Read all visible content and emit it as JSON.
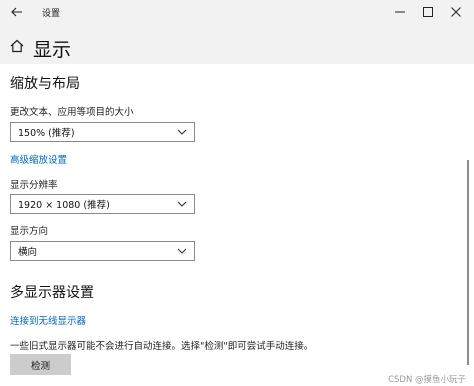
{
  "window": {
    "title": "设置",
    "back_icon": "back-arrow-icon",
    "minimize_icon": "minimize-icon",
    "maximize_icon": "maximize-icon",
    "close_icon": "close-icon"
  },
  "header": {
    "icon": "home-icon",
    "title": "显示"
  },
  "scale_layout": {
    "heading": "缩放与布局",
    "text_size_label": "更改文本、应用等项目的大小",
    "text_size_value": "150% (推荐)",
    "advanced_scaling_link": "高级缩放设置",
    "resolution_label": "显示分辨率",
    "resolution_value": "1920 × 1080 (推荐)",
    "orientation_label": "显示方向",
    "orientation_value": "横向"
  },
  "multi_display": {
    "heading": "多显示器设置",
    "wireless_link": "连接到无线显示器",
    "description": "一些旧式显示器可能不会进行自动连接。选择\"检测\"即可尝试手动连接。",
    "detect_button": "检测"
  },
  "watermark": "CSDN @摸鱼小玩子",
  "colors": {
    "accent_link": "#0067c0",
    "header_bg": "#f2f2f2",
    "button_bg": "#cccccc"
  }
}
